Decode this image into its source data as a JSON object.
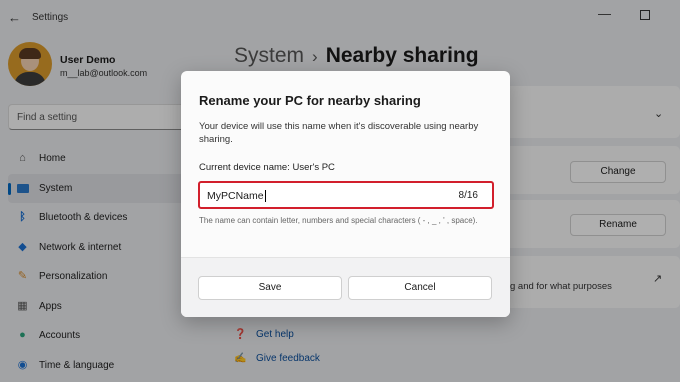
{
  "window": {
    "title": "Settings"
  },
  "user": {
    "name": "User Demo",
    "email": "m__lab@outlook.com"
  },
  "search": {
    "placeholder": "Find a setting"
  },
  "nav": [
    {
      "label": "Home",
      "icon": "home-icon",
      "active": false
    },
    {
      "label": "System",
      "icon": "system-icon",
      "active": true
    },
    {
      "label": "Bluetooth & devices",
      "icon": "bluetooth-icon",
      "active": false
    },
    {
      "label": "Network & internet",
      "icon": "wifi-icon",
      "active": false
    },
    {
      "label": "Personalization",
      "icon": "brush-icon",
      "active": false
    },
    {
      "label": "Apps",
      "icon": "apps-icon",
      "active": false
    },
    {
      "label": "Accounts",
      "icon": "person-icon",
      "active": false
    },
    {
      "label": "Time & language",
      "icon": "globe-icon",
      "active": false
    }
  ],
  "breadcrumb": {
    "parent": "System",
    "separator": "›",
    "current": "Nearby sharing"
  },
  "background": {
    "change_button": "Change",
    "rename_button": "Rename",
    "card_text": "g and for what purposes"
  },
  "links": {
    "get_help": "Get help",
    "give_feedback": "Give feedback"
  },
  "dialog": {
    "title": "Rename your PC for nearby sharing",
    "description": "Your device will use this name when it's discoverable using nearby sharing.",
    "current_name": "Current device name: User's PC",
    "field_value": "MyPCName",
    "char_count": "8/16",
    "hint": "The name can contain letter, numbers and special characters ( - , _ , ' , space).",
    "save_label": "Save",
    "cancel_label": "Cancel"
  },
  "colors": {
    "accent": "#0067c0",
    "highlight_border": "#d21f2c"
  }
}
